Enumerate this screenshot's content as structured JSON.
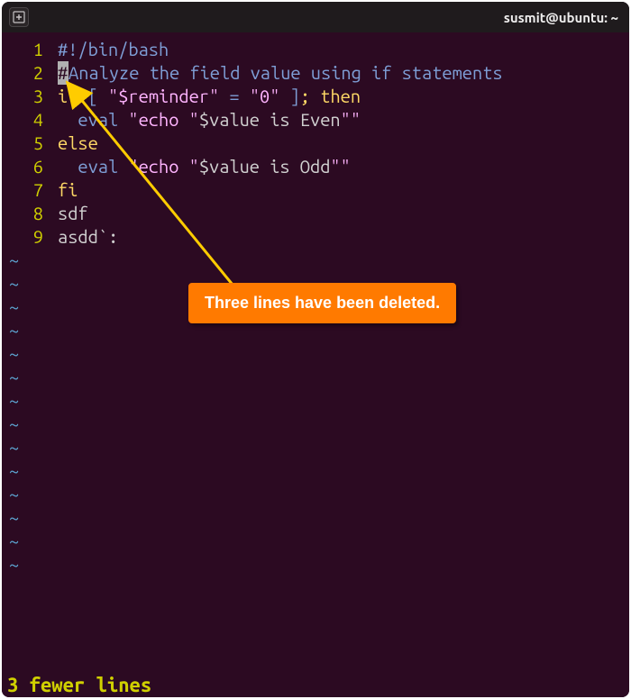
{
  "window": {
    "title": "susmit@ubuntu: ~"
  },
  "editor": {
    "lines": [
      {
        "n": "1",
        "segs": [
          {
            "cls": "t-comment",
            "text": "#!/bin/bash"
          }
        ]
      },
      {
        "n": "2",
        "cursor_prefix": "#",
        "segs": [
          {
            "cls": "t-comment",
            "text": "Analyze the field value using if statements"
          }
        ]
      },
      {
        "n": "3",
        "segs": [
          {
            "cls": "t-key",
            "text": "if "
          },
          {
            "cls": "t-cond",
            "text": "[ "
          },
          {
            "cls": "t-str",
            "text": "\"$reminder\""
          },
          {
            "cls": "t-cond",
            "text": " = "
          },
          {
            "cls": "t-str",
            "text": "\"0\""
          },
          {
            "cls": "t-cond",
            "text": " ]"
          },
          {
            "cls": "t-key",
            "text": "; then"
          }
        ]
      },
      {
        "n": "4",
        "segs": [
          {
            "cls": "t-plain",
            "text": "  "
          },
          {
            "cls": "t-cmd",
            "text": "eval "
          },
          {
            "cls": "t-str",
            "text": "\"echo \""
          },
          {
            "cls": "t-var",
            "text": "$value is Even"
          },
          {
            "cls": "t-str",
            "text": "\"\""
          }
        ]
      },
      {
        "n": "5",
        "segs": [
          {
            "cls": "t-key",
            "text": "else"
          }
        ]
      },
      {
        "n": "6",
        "segs": [
          {
            "cls": "t-plain",
            "text": "  "
          },
          {
            "cls": "t-cmd",
            "text": "eval "
          },
          {
            "cls": "t-str",
            "text": "\"echo \""
          },
          {
            "cls": "t-var",
            "text": "$value is Odd"
          },
          {
            "cls": "t-str",
            "text": "\"\""
          }
        ]
      },
      {
        "n": "7",
        "segs": [
          {
            "cls": "t-key",
            "text": "fi"
          }
        ]
      },
      {
        "n": "8",
        "segs": [
          {
            "cls": "t-plain",
            "text": "sdf"
          }
        ]
      },
      {
        "n": "9",
        "segs": [
          {
            "cls": "t-plain",
            "text": "asdd`:"
          }
        ]
      }
    ],
    "tilde_count": 14,
    "tilde": "~"
  },
  "status": {
    "text": "3 fewer lines"
  },
  "annotation": {
    "text": "Three lines have been deleted."
  }
}
